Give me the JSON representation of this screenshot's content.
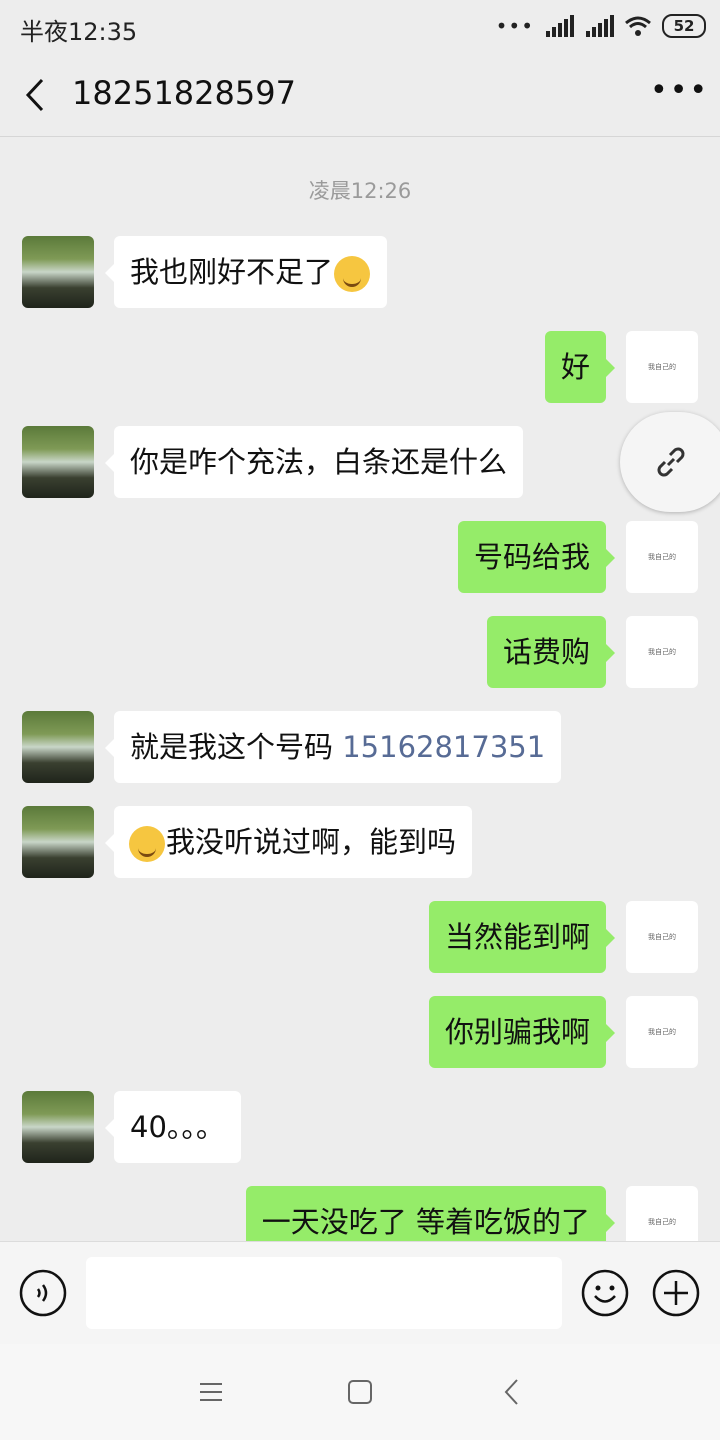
{
  "status_bar": {
    "time": "半夜12:35",
    "battery": "52"
  },
  "header": {
    "title": "18251828597"
  },
  "chat": {
    "timestamp": "凌晨12:26",
    "self_avatar_text": "我自己的",
    "messages": [
      {
        "side": "left",
        "text": "我也刚好不足了",
        "emoji_after": "sweat-emoji"
      },
      {
        "side": "right",
        "text": "好"
      },
      {
        "side": "left",
        "text": "你是咋个充法，白条还是什么"
      },
      {
        "side": "right",
        "text": "号码给我"
      },
      {
        "side": "right",
        "text": "话费购"
      },
      {
        "side": "left",
        "text": "就是我这个号码 ",
        "link_text": "15162817351"
      },
      {
        "side": "left",
        "emoji_before": "laughing-tears-emoji",
        "text": "我没听说过啊，能到吗"
      },
      {
        "side": "right",
        "text": "当然能到啊"
      },
      {
        "side": "right",
        "text": "你别骗我啊"
      },
      {
        "side": "left",
        "text": "40。。。"
      },
      {
        "side": "right",
        "text": "一天没吃了  等着吃饭的了"
      }
    ]
  },
  "input_bar": {
    "placeholder": ""
  },
  "colors": {
    "background": "#ededed",
    "self_bubble": "#95ec69",
    "other_bubble": "#ffffff",
    "link": "#576b95"
  }
}
